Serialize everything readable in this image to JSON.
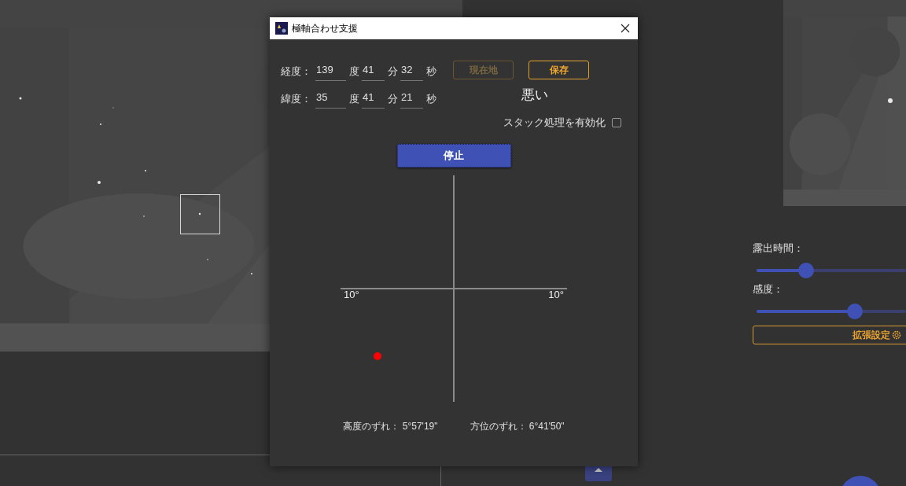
{
  "main": {
    "exposure": {
      "label": "露出時間：",
      "level": 0.33
    },
    "sensitivity": {
      "label": "感度：",
      "level": 0.66
    },
    "advanced_button": "拡張設定"
  },
  "dialog": {
    "title": "極軸合わせ支援",
    "longitude": {
      "label": "経度：",
      "deg": "139",
      "deg_unit": "度",
      "min": "41",
      "min_unit": "分",
      "sec": "32",
      "sec_unit": "秒"
    },
    "latitude": {
      "label": "緯度：",
      "deg": "35",
      "deg_unit": "度",
      "min": "41",
      "min_unit": "分",
      "sec": "21",
      "sec_unit": "秒"
    },
    "current_location_button": {
      "label": "現在地",
      "disabled": true
    },
    "save_button": {
      "label": "保存",
      "disabled": false
    },
    "quality": "悪い",
    "stacking": {
      "label": "スタック処理を有効化",
      "checked": false
    },
    "stop_button": "停止",
    "target_plot": {
      "left_label": "10°",
      "right_label": "10°"
    },
    "altitude_offset": {
      "label": "高度のずれ：",
      "value": "5°57'19\""
    },
    "azimuth_offset": {
      "label": "方位のずれ：",
      "value": "6°41'50\""
    }
  }
}
